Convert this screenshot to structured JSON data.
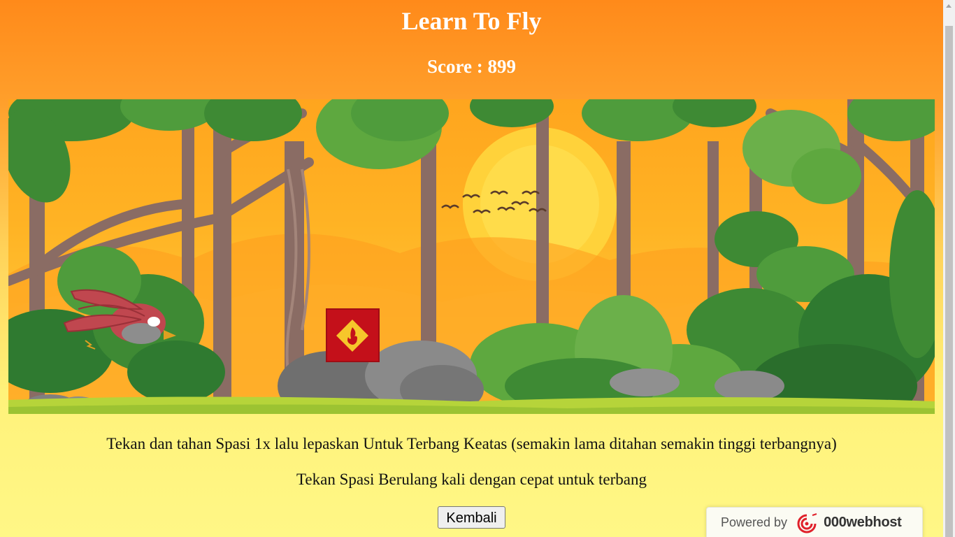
{
  "header": {
    "title": "Learn To Fly",
    "score_label": "Score :",
    "score_value": "899"
  },
  "game": {
    "player": "red-bird",
    "obstacle": "fire-block"
  },
  "instructions": {
    "line1": "Tekan dan tahan Spasi 1x lalu lepaskan Untuk Terbang Keatas (semakin lama ditahan semakin tinggi terbangnya)",
    "line2": "Tekan Spasi Berulang kali dengan cepat untuk terbang"
  },
  "buttons": {
    "back_label": "Kembali"
  },
  "footer": {
    "powered_by": "Powered by",
    "brand": "000webhost"
  },
  "colors": {
    "header_bg": "#ff8a1a",
    "obstacle": "#c4101a",
    "bird": "#c0474f"
  }
}
